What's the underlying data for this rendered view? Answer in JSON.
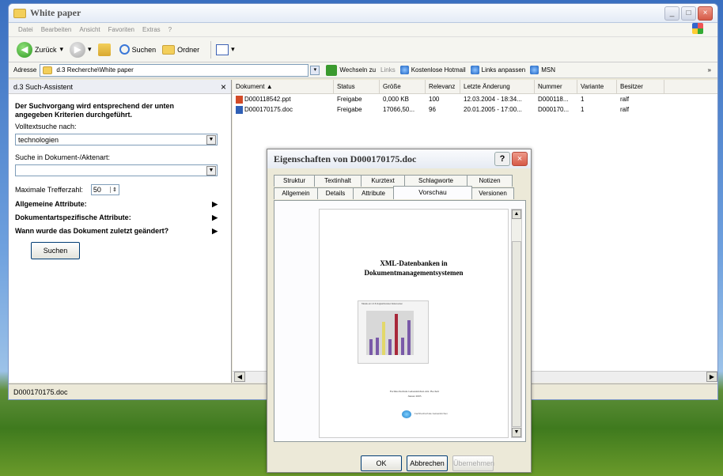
{
  "window": {
    "title": "White paper"
  },
  "menu": [
    "Datei",
    "Bearbeiten",
    "Ansicht",
    "Favoriten",
    "Extras",
    "?"
  ],
  "toolbar": {
    "back": "Zurück",
    "search": "Suchen",
    "folders": "Ordner"
  },
  "address": {
    "label": "Adresse",
    "value": "d.3 Recherche\\White paper",
    "go": "Wechseln zu",
    "links": "Links",
    "link1": "Kostenlose Hotmail",
    "link2": "Links anpassen",
    "link3": "MSN",
    "more": "»"
  },
  "assistant": {
    "title": "d.3 Such-Assistent",
    "close": "×",
    "intro": "Der Suchvorgang wird entsprechend der unten angegeben Kriterien durchgeführt.",
    "fulltext_label": "Volltextsuche nach:",
    "fulltext_value": "technologien",
    "doctype_label": "Suche in Dokument-/Aktenart:",
    "doctype_value": "",
    "max_label": "Maximale Trefferzahl:",
    "max_value": "50",
    "attr1": "Allgemeine Attribute:",
    "attr2": "Dokumentartspezifische Attribute:",
    "attr3": "Wann wurde das Dokument zuletzt geändert?",
    "search_button": "Suchen"
  },
  "table": {
    "headers": [
      "Dokument",
      "Status",
      "Größe",
      "Relevanz",
      "Letzte Änderung",
      "Nummer",
      "Variante",
      "Besitzer"
    ],
    "rows": [
      [
        "D000118542.ppt",
        "Freigabe",
        "0,000 KB",
        "100",
        "12.03.2004 - 18:34...",
        "D000118...",
        "1",
        "ralf"
      ],
      [
        "D000170175.doc",
        "Freigabe",
        "17066,50...",
        "96",
        "20.01.2005 - 17:00...",
        "D000170...",
        "1",
        "ralf"
      ]
    ]
  },
  "statusbar": {
    "text": "D000170175.doc"
  },
  "dialog": {
    "title": "Eigenschaften von D000170175.doc",
    "help": "?",
    "close": "×",
    "tabs_row1": [
      "Struktur",
      "Textinhalt",
      "Kurztext",
      "Schlagworte",
      "Notizen"
    ],
    "tabs_row2": [
      "Allgemein",
      "Details",
      "Attribute",
      "Vorschau",
      "Versionen"
    ],
    "active_tab": "Vorschau",
    "preview": {
      "heading_line1": "XML-Datenbanken in",
      "heading_line2": "Dokumentmanagementsystemen",
      "figure_caption": "Tabelle ein 2.3.8 Vergleichszeiten Dokumenten",
      "footer_line1": "Fachhochschule Gelsenkirchen Abt. Bocholt",
      "footer_line2": "Januar 2005",
      "logo_text": "Fachhochschule Gelsenkirchen"
    },
    "ok": "OK",
    "cancel": "Abbrechen",
    "apply": "Übernehmen"
  },
  "colors": {
    "accent": "#3b78d8",
    "bar_violet": "#7a5aa8",
    "bar_red": "#a8283a",
    "bar_yellow": "#e3d86a"
  }
}
